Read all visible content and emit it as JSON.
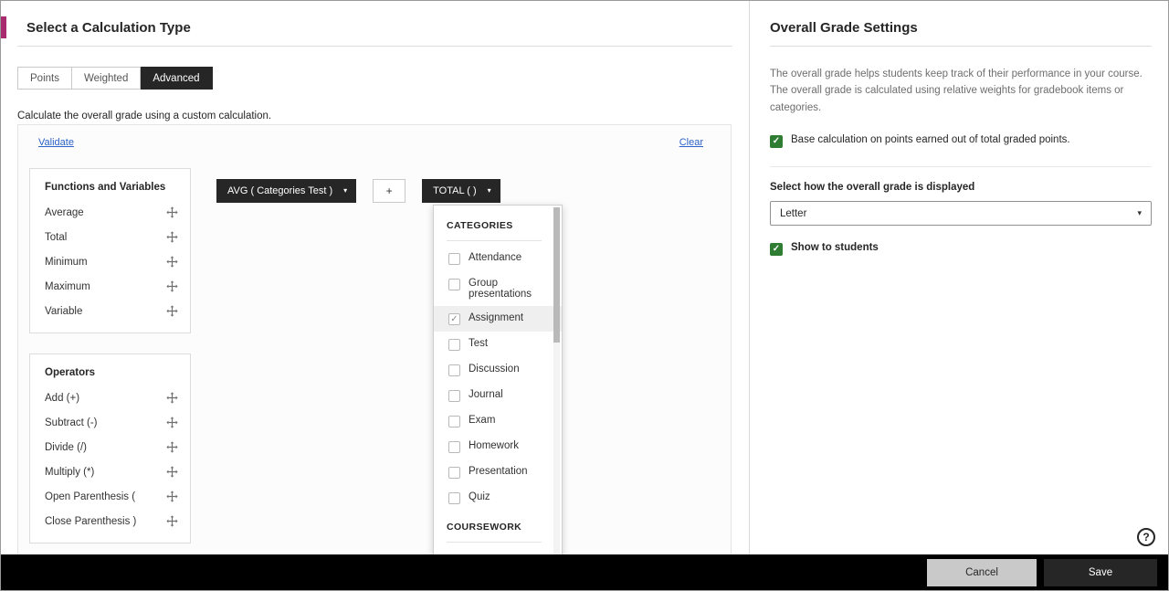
{
  "icons": {
    "caret": "▾",
    "check": "✓",
    "help": "?"
  },
  "colors": {
    "accent": "#a72b6e",
    "checkbox_green": "#2e7d32",
    "chip_dark": "#262626",
    "link_blue": "#2d62c6"
  },
  "left": {
    "title": "Select a Calculation Type",
    "tabs": [
      {
        "label": "Points",
        "active": false
      },
      {
        "label": "Weighted",
        "active": false
      },
      {
        "label": "Advanced",
        "active": true
      }
    ],
    "description": "Calculate the overall grade using a custom calculation.",
    "validate_link": "Validate",
    "clear_link": "Clear",
    "functions_panel": {
      "title": "Functions and Variables",
      "items": [
        "Average",
        "Total",
        "Minimum",
        "Maximum",
        "Variable"
      ]
    },
    "operators_panel": {
      "title": "Operators",
      "items": [
        "Add (+)",
        "Subtract (-)",
        "Divide (/)",
        "Multiply (*)",
        "Open Parenthesis (",
        "Close Parenthesis )"
      ]
    },
    "formula_chips": [
      {
        "label": "AVG ( Categories Test )",
        "type": "dropdown"
      },
      {
        "label": "+",
        "type": "operator"
      },
      {
        "label": "TOTAL ( )",
        "type": "dropdown"
      }
    ],
    "categories_dropdown": {
      "sections": [
        {
          "header": "CATEGORIES",
          "items": [
            {
              "label": "Attendance",
              "checked": false
            },
            {
              "label": "Group presentations",
              "checked": false
            },
            {
              "label": "Assignment",
              "checked": true,
              "highlighted": true
            },
            {
              "label": "Test",
              "checked": false
            },
            {
              "label": "Discussion",
              "checked": false
            },
            {
              "label": "Journal",
              "checked": false
            },
            {
              "label": "Exam",
              "checked": false
            },
            {
              "label": "Homework",
              "checked": false
            },
            {
              "label": "Presentation",
              "checked": false
            },
            {
              "label": "Quiz",
              "checked": false
            }
          ]
        },
        {
          "header": "COURSEWORK",
          "items": [
            {
              "label": "",
              "checked": false
            }
          ]
        }
      ]
    }
  },
  "right": {
    "title": "Overall Grade Settings",
    "description": "The overall grade helps students keep track of their performance in your course. The overall grade is calculated using relative weights for gradebook items or categories.",
    "base_points_checkbox": {
      "label": "Base calculation on points earned out of total graded points.",
      "checked": true
    },
    "display_select": {
      "label": "Select how the overall grade is displayed",
      "value": "Letter"
    },
    "show_students_checkbox": {
      "label": "Show to students",
      "checked": true
    }
  },
  "footer": {
    "cancel_label": "Cancel",
    "save_label": "Save"
  }
}
